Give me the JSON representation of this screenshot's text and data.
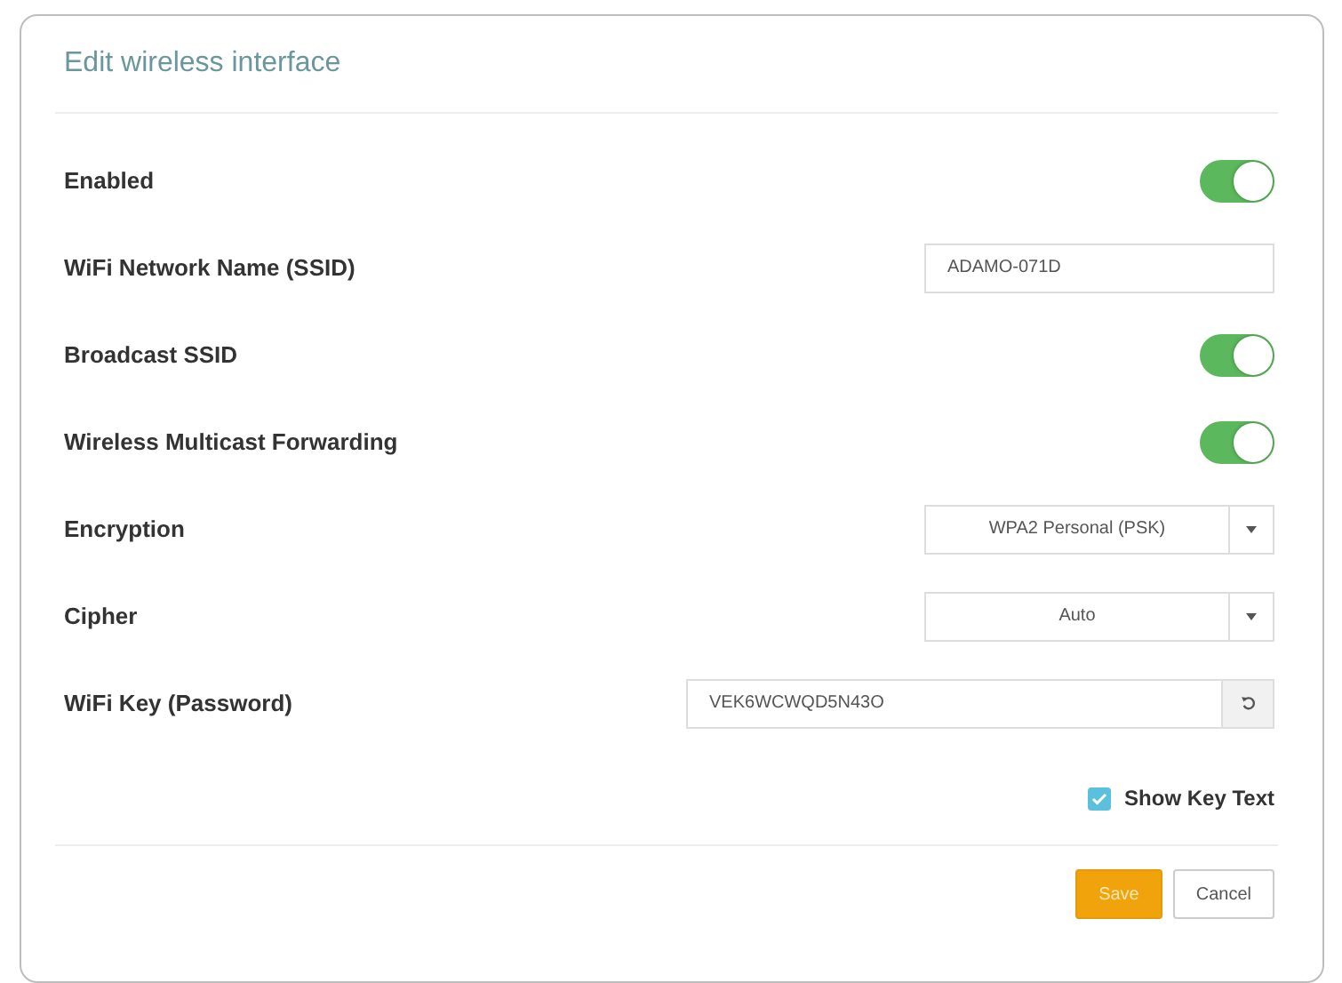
{
  "dialog": {
    "title": "Edit wireless interface"
  },
  "fields": [
    {
      "kind": "toggle",
      "label": "Enabled",
      "on": true
    },
    {
      "kind": "text",
      "label": "WiFi Network Name (SSID)",
      "value": "ADAMO-071D"
    },
    {
      "kind": "toggle",
      "label": "Broadcast SSID",
      "on": true
    },
    {
      "kind": "toggle",
      "label": "Wireless Multicast Forwarding",
      "on": true
    },
    {
      "kind": "select",
      "label": "Encryption",
      "value": "WPA2 Personal (PSK)"
    },
    {
      "kind": "select",
      "label": "Cipher",
      "value": "Auto"
    },
    {
      "kind": "password",
      "label": "WiFi Key (Password)",
      "value": "VEK6WCWQD5N43O"
    }
  ],
  "show_key": {
    "label": "Show Key Text",
    "checked": true
  },
  "buttons": [
    {
      "kind": "primary",
      "label": "Save"
    },
    {
      "kind": "secondary",
      "label": "Cancel"
    }
  ]
}
